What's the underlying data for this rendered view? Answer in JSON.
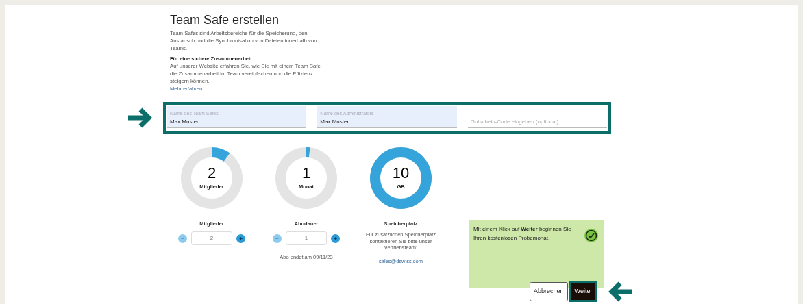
{
  "title": "Team Safe erstellen",
  "intro": "Team Safes sind Arbeitsbereiche für die Speicherung, den Austausch und die Synchronisation von Dateien innerhalb von Teams.",
  "subheading": "Für eine sichere Zusammenarbeit",
  "subtext": "Auf unserer Website erfahren Sie, wie Sie mit einem Team Safe die Zusammenarbeit im Team vereinfachen und die Effizienz steigern können.",
  "link": "Mehr erfahren",
  "fields": [
    {
      "kind": "filled",
      "label": "Name des Team Safes",
      "value": "Max Muster"
    },
    {
      "kind": "filled",
      "label": "Name des Administrators",
      "value": "Max Muster"
    },
    {
      "kind": "empty",
      "placeholder": "Gutschein-Code eingeben (optional)"
    }
  ],
  "meters": [
    {
      "kind": "stepper",
      "value": "2",
      "unit": "Mitglieder",
      "label": "Mitglieder",
      "input": "2",
      "minus": "−",
      "plus": "+",
      "minus_disabled": true
    },
    {
      "kind": "stepper",
      "value": "1",
      "unit": "Monat",
      "label": "Abodauer",
      "input": "1",
      "minus": "−",
      "plus": "+",
      "minus_disabled": true,
      "note": "Abo endet am 09/11/23"
    },
    {
      "kind": "info",
      "value": "10",
      "unit": "GB",
      "label": "Speicherplatz",
      "text": "Für zusätzlichen Speicherplatz kontaktieren Sie bitte unser Vertriebsteam:",
      "email": "sales@dswiss.com"
    }
  ],
  "notice": "Mit einem Klick auf **Weiter** beginnen Sie Ihren kostenlosen Probemonat.",
  "buttons": [
    {
      "label": "Abbrechen",
      "primary": false
    },
    {
      "label": "Weiter",
      "primary": true
    }
  ]
}
